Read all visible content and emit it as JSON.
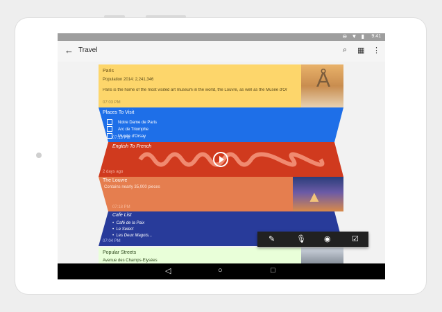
{
  "status": {
    "time": "9:41",
    "icons": "⊖ ▼ ▮"
  },
  "appbar": {
    "title": "Travel",
    "back_icon": "arrow-back-icon",
    "search_icon": "search-icon",
    "grid_icon": "grid-icon",
    "menu_icon": "more-vert-icon"
  },
  "cards": {
    "paris": {
      "title": "Paris",
      "population": "Population 2014: 2,241,346",
      "desc": "Paris is the home of the most visited art museum in the world, the Louvre, as well as the Musée d'Or",
      "time": "07:03 PM",
      "color": "#fdd66b"
    },
    "places": {
      "title": "Places To Visit",
      "items": [
        "Notre Dame de Paris",
        "Arc de Triomphe",
        "Musée d'Orsay"
      ],
      "time": "07:13 PM",
      "color": "#1e6fe8"
    },
    "audio": {
      "title": "English To French",
      "time": "2 days ago",
      "color": "#d03a1e"
    },
    "louvre": {
      "title": "The Louvre",
      "desc": "Contains nearly 35,000 pieces",
      "time": "07:18 PM",
      "color": "#e57e4f"
    },
    "cafe": {
      "title": "Cafe List",
      "items": [
        "Café de la Paix",
        "Le Select",
        "Les Deux Magots..."
      ],
      "time": "07:04 PM",
      "color": "#283b9a"
    },
    "streets": {
      "title": "Popular Streets",
      "item": "Avenue des Champs-Elysées",
      "color": "#e9ffd9"
    }
  },
  "toolbar": {
    "items": [
      "pencil-icon",
      "mic-icon",
      "camera-icon",
      "checkbox-icon"
    ]
  },
  "nav": {
    "back": "◁",
    "home": "○",
    "recents": "□"
  }
}
